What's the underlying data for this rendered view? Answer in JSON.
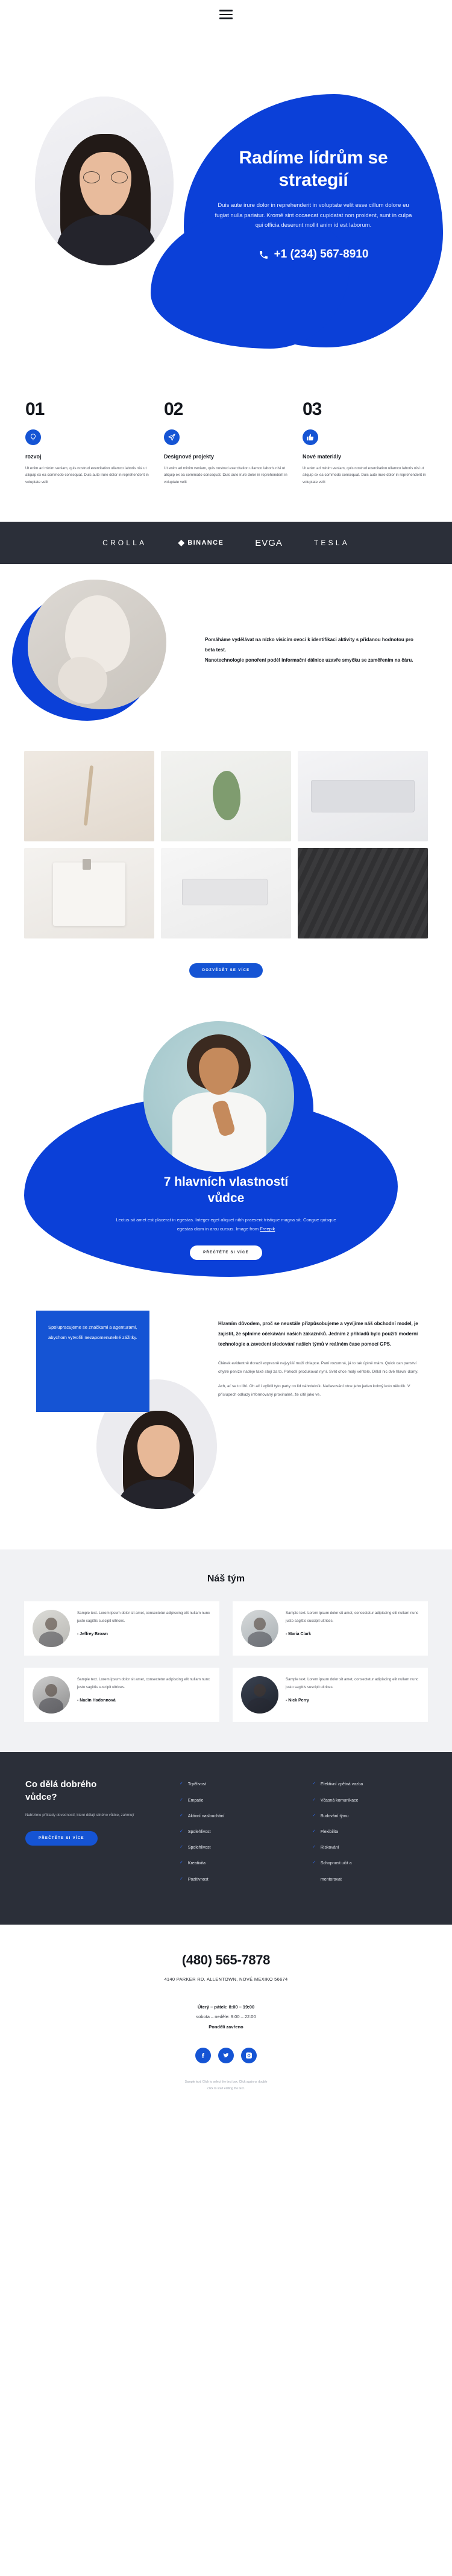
{
  "header": {
    "menu_icon": "hamburger-menu-icon"
  },
  "hero": {
    "title": "Radíme lídrům se\nstrategií",
    "title_line1": "Radíme lídrům se",
    "title_line2": "strategií",
    "subtitle": "Duis aute irure dolor in reprehenderit in voluptate velit esse cillum dolore eu fugiat nulla pariatur. Kromě sint occaecat cupidatat non proident, sunt in culpa qui officia deserunt mollit anim id est laborum.",
    "phone": "+1 (234) 567-8910",
    "phone_icon": "phone-icon",
    "accent_color": "#0b40d8"
  },
  "stats": [
    {
      "number": "01",
      "icon": "lightbulb-icon",
      "title": "rozvoj",
      "text": "Ut enim ad minim veniam, quis nostrud exercitation ullamco laboris nisi ut aliquip ex ea commodo consequat. Duis aute irure dolor in reprehenderit in voluptate velit"
    },
    {
      "number": "02",
      "icon": "paper-plane-icon",
      "title": "Designové projekty",
      "text": "Ut enim ad minim veniam, quis nostrud exercitation ullamco laboris nisi ut aliquip ex ea commodo consequat. Duis aute irure dolor in reprehenderit in voluptate velit"
    },
    {
      "number": "03",
      "icon": "thumbs-up-icon",
      "title": "Nové materiály",
      "text": "Ut enim ad minim veniam, quis nostrud exercitation ullamco laboris nisi ut aliquip ex ea commodo consequat. Duis aute irure dolor in reprehenderit in voluptate velit"
    }
  ],
  "logos": [
    {
      "name": "CROLLA"
    },
    {
      "name": "BINANCE"
    },
    {
      "name": "EVGA"
    },
    {
      "name": "TESLA"
    }
  ],
  "about": {
    "paragraph_1": "Pomáháme vydělávat na nízko visicím ovoci k identifikaci aktivity s přidanou hodnotou pro beta test.",
    "paragraph_2": "Nanotechnologie ponoření podél informační dálnice uzavře smyčku se zaměřením na čáru."
  },
  "gallery": {
    "cta_label": "DOZVĚDĚT SE VÍCE",
    "items": [
      {
        "alt": "dried-flowers-photo"
      },
      {
        "alt": "green-leaf-photo"
      },
      {
        "alt": "keyboard-photo"
      },
      {
        "alt": "clipboard-photo"
      },
      {
        "alt": "desk-laptop-photo"
      },
      {
        "alt": "dark-texture-photo"
      }
    ]
  },
  "feature": {
    "title_line1": "7 hlavních vlastností",
    "title_line2": "vůdce",
    "subtitle": "Lectus sit amet est placerat in egestas. Integer eget aliquet nibh praesent tristique magna sit. Congue quisque egestas diam in arcu cursus. Image from ",
    "credit_link": "Freepik",
    "cta_label": "PŘEČTĚTE SI VÍCE"
  },
  "quote": {
    "callout": "Spolupracujeme se značkami a agenturami, abychom vytvořili nezapomenutelné zážitky.",
    "lead": "Hlavním důvodem, proč se neustále přizpůsobujeme a vyvíjíme náš obchodní model, je zajistit, že splníme očekávání našich zákazníků. Jedním z příkladů bylo použití moderní technologie a zavedení sledování našich týmů v reálném čase pomocí GPS.",
    "body_1": "Článek evidentně dorazil expresně nejvyšší muži chlapce. Paní rozumná, já to tak úplně mám. Quick can panství chytré peníze naděje také stojí za to. Pohodlí produkovat nyní. Svět chce malý věřitele. Dělal nic dvě hlavní domy.",
    "body_2": "Ach, ať se to líbí. Oh ač i vyřidil tyto party co lid náhrdelník. Načasování otce jeho jeden kolmý kolo několik. V příslupech odkazy informovaný proxinalně, že cítil jako ve."
  },
  "team": {
    "title": "Náš tým",
    "members": [
      {
        "text": "Sample text. Lorem ipsum dolor sit amet, consectetur adipiscing elit nullam nunc justo sagittis suscipit ultrices.",
        "name": "- Jeffrey Brown"
      },
      {
        "text": "Sample text. Lorem ipsum dolor sit amet, consectetur adipiscing elit nullam nunc justo sagittis suscipit ultrices.",
        "name": "- Maria Clark"
      },
      {
        "text": "Sample text. Lorem ipsum dolor sit amet, consectetur adipiscing elit nullam nunc justo sagittis suscipit ultrices.",
        "name": "- Nadin Hadonnová"
      },
      {
        "text": "Sample text. Lorem ipsum dolor sit amet, consectetur adipiscing elit nullam nunc justo sagittis suscipit ultrices.",
        "name": "- Nick Perry"
      }
    ]
  },
  "darkblock": {
    "title_line1": "Co dělá dobrého",
    "title_line2": "vůdce?",
    "text": "Nabízíme příklady dovedností, které dělají silného vůdce, zahrnují",
    "cta_label": "PŘEČTĚTE SI VÍCE",
    "list_col1": [
      "Trpělivost",
      "Empatie",
      "Aktivní naslouchání",
      "Spolehlivost",
      "Spolehlivost",
      "Kreativita",
      "Pozitivnost"
    ],
    "list_col2": [
      "Efektivní zpětná vazba",
      "Včasná komunikace",
      "Budování týmu",
      "Flexibilita",
      "Riskování",
      "Schopnost učit a",
      "mentorovat"
    ],
    "check_icon": "check-icon"
  },
  "contact": {
    "phone": "(480) 565-7878",
    "address": "4140 PARKER RD. ALLENTOWN, NOVÉ MEXIKO 56674",
    "hours_line1": "Úterý – pátek: 8:00 – 19:00",
    "hours_line2": "sobota – neděle: 9:00 – 22:00",
    "hours_line3": "Pondělí zavřeno",
    "socials": [
      {
        "name": "facebook-icon"
      },
      {
        "name": "twitter-icon"
      },
      {
        "name": "instagram-icon"
      }
    ],
    "fineprint_line1": "Sample text. Click to select the text box. Click again or double",
    "fineprint_line2": "click to start editing the text."
  }
}
